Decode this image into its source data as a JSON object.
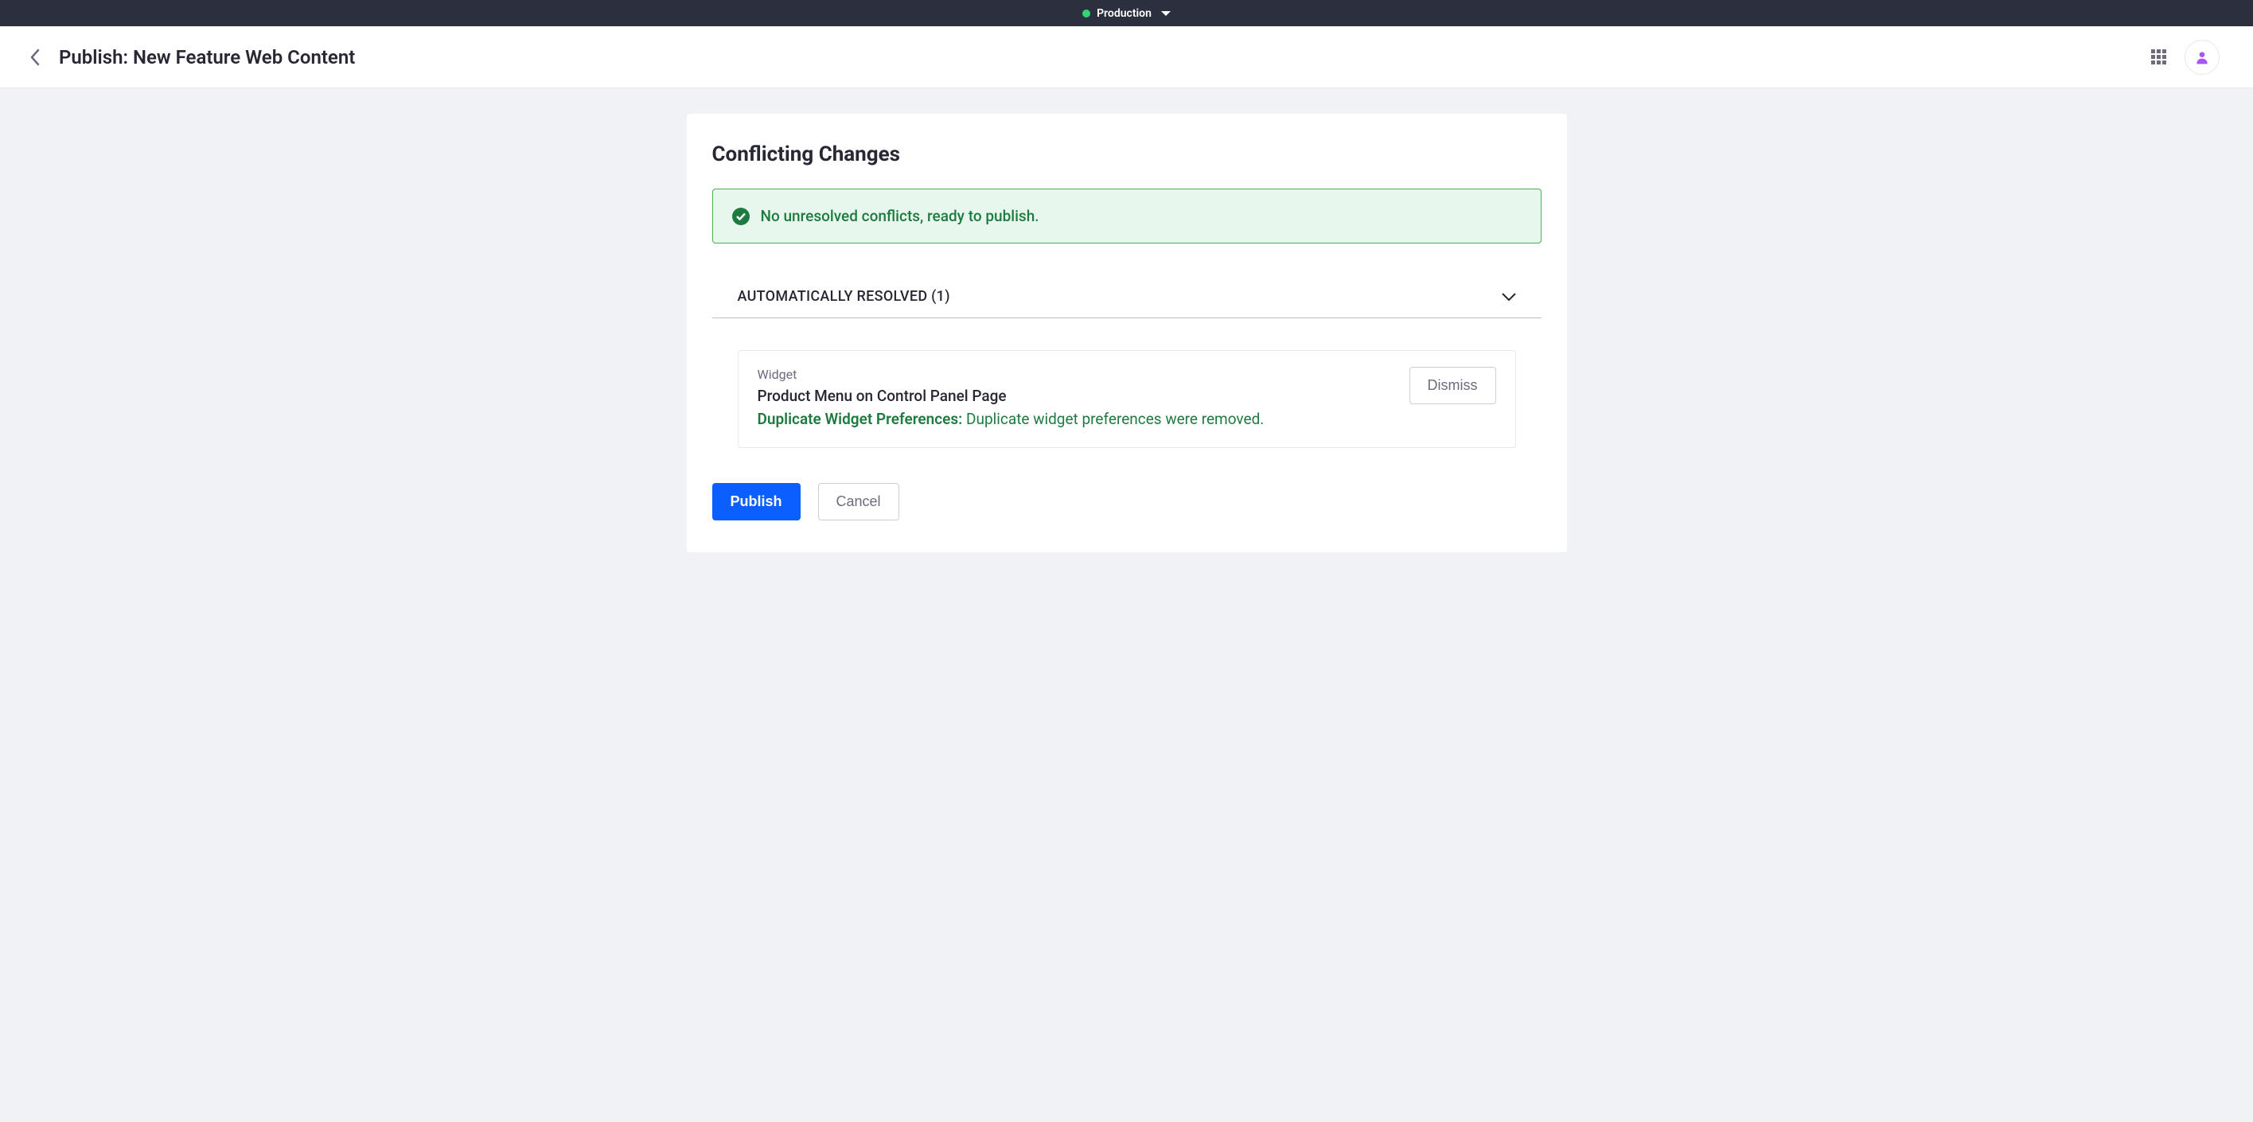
{
  "topbar": {
    "env_label": "Production"
  },
  "header": {
    "title": "Publish: New Feature Web Content"
  },
  "main": {
    "heading": "Conflicting Changes",
    "alert": {
      "message": "No unresolved conflicts, ready to publish."
    },
    "section": {
      "label": "AUTOMATICALLY RESOLVED (1)"
    },
    "conflict": {
      "type": "Widget",
      "title": "Product Menu on Control Panel Page",
      "desc_strong": "Duplicate Widget Preferences:",
      "desc_rest": " Duplicate widget preferences were removed.",
      "dismiss_label": "Dismiss"
    },
    "actions": {
      "publish": "Publish",
      "cancel": "Cancel"
    }
  }
}
